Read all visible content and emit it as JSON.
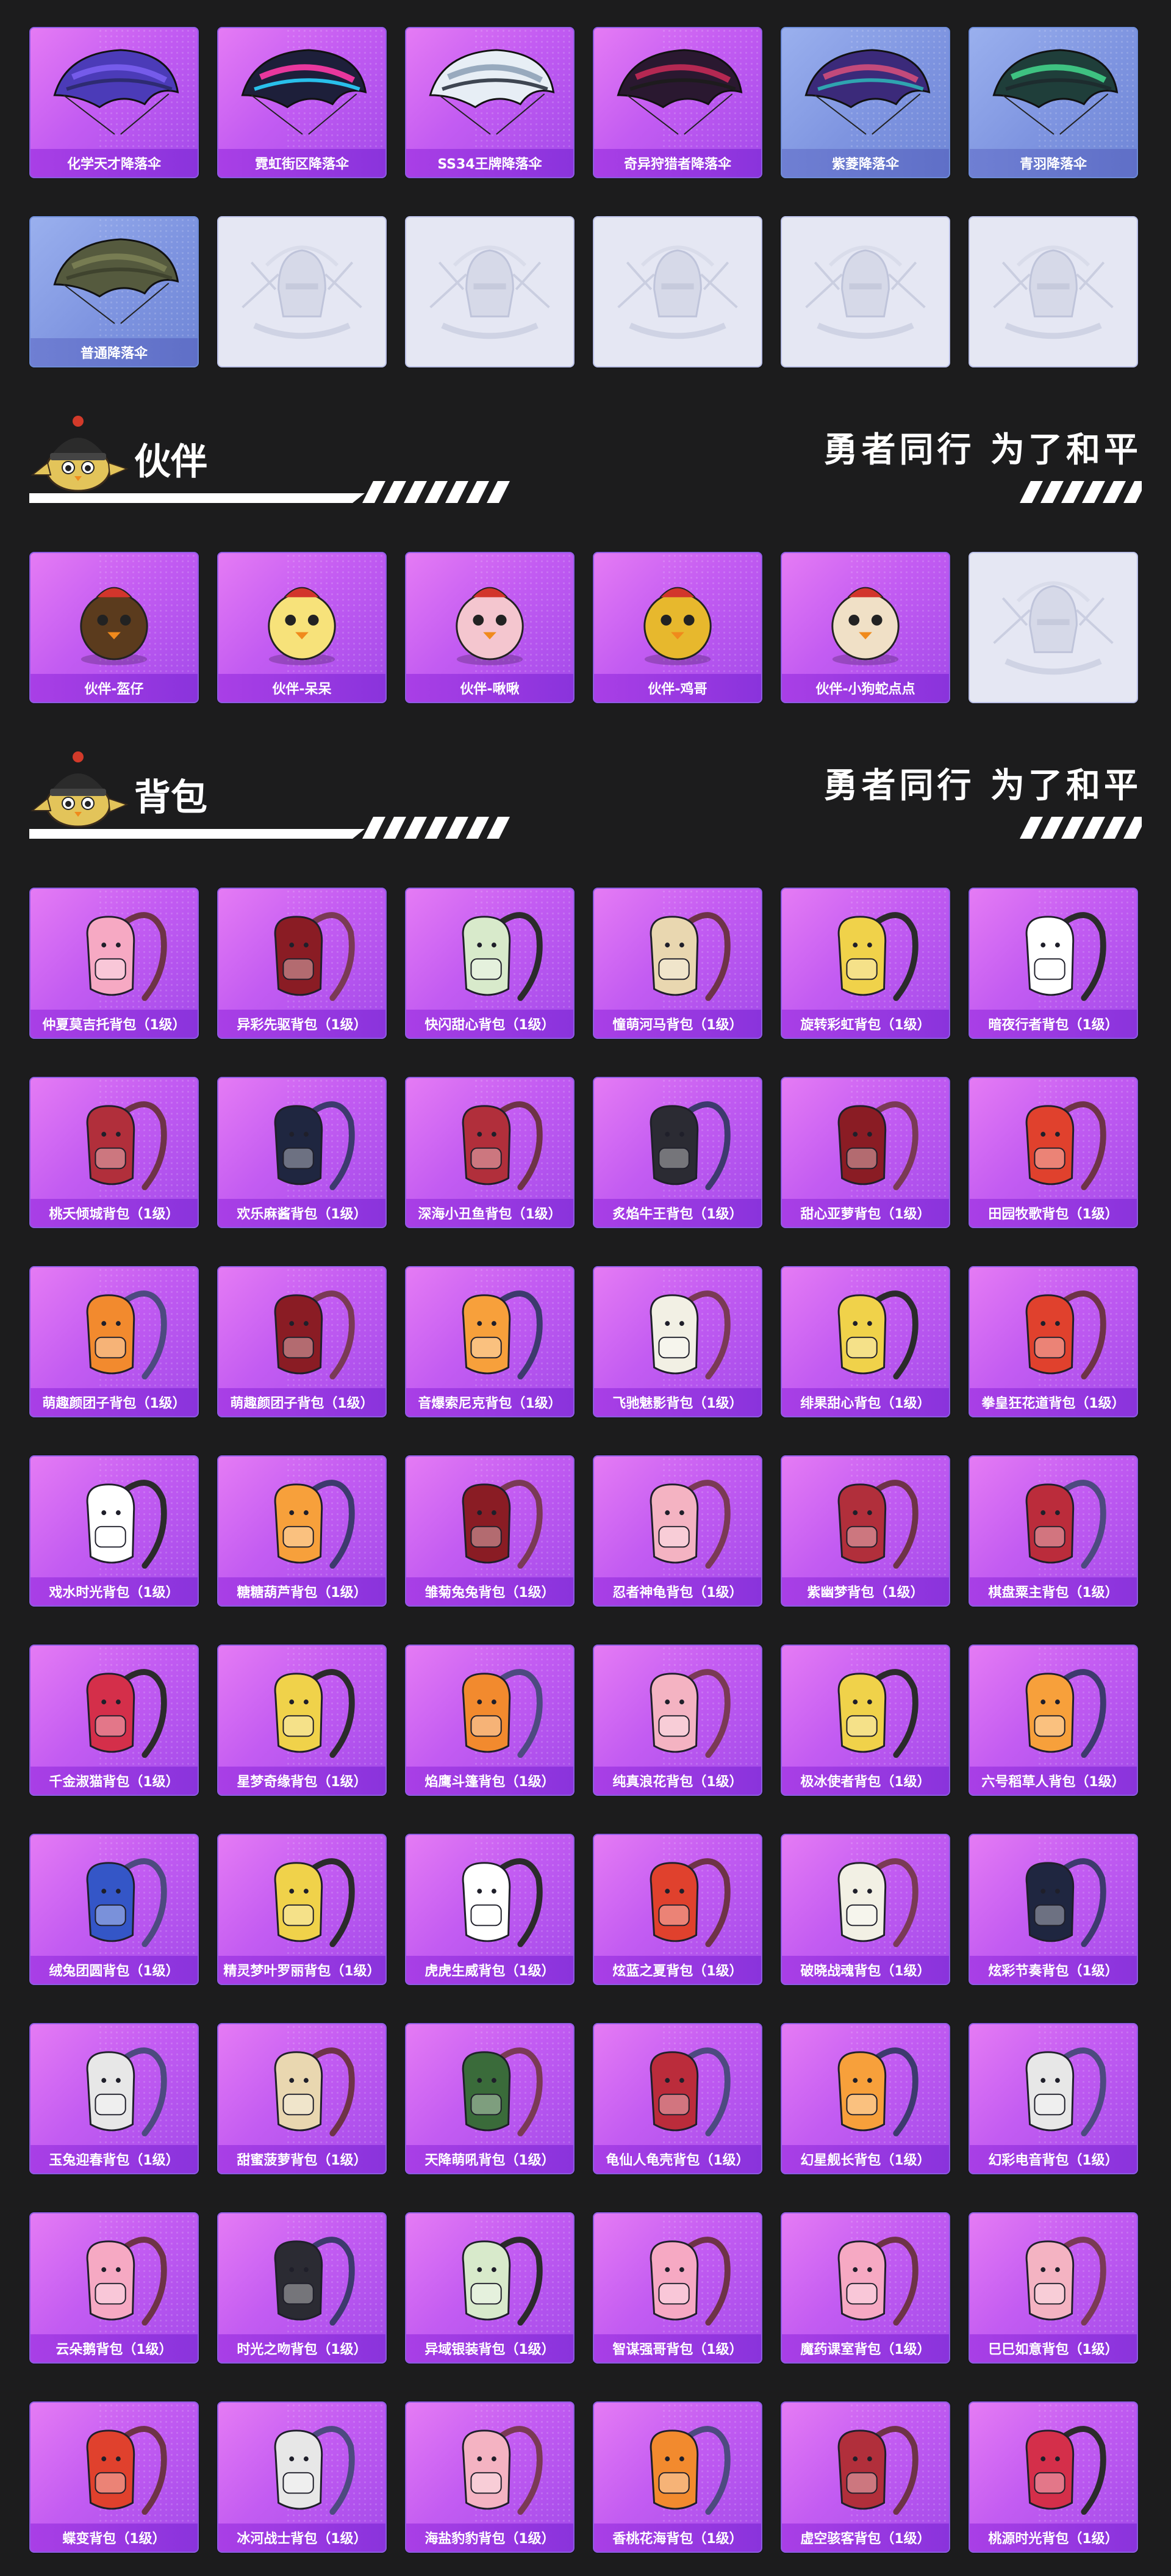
{
  "parachute_row1": [
    "化学天才降落伞",
    "霓虹街区降落伞",
    "SS34王牌降落伞",
    "奇异狩猎者降落伞",
    "紫菱降落伞",
    "青羽降落伞"
  ],
  "parachute_row2": [
    "普通降落伞",
    "",
    "",
    "",
    "",
    ""
  ],
  "companion_section": {
    "title": "伙伴",
    "slogan": "勇者同行 为了和平",
    "items": [
      "伙伴-盔仔",
      "伙伴-呆呆",
      "伙伴-啾啾",
      "伙伴-鸡哥",
      "伙伴-小狗蛇点点",
      ""
    ]
  },
  "backpack_section": {
    "title": "背包",
    "slogan": "勇者同行 为了和平",
    "items": [
      "仲夏莫吉托背包（1级）",
      "异彩先驱背包（1级）",
      "快闪甜心背包（1级）",
      "憧萌河马背包（1级）",
      "旋转彩虹背包（1级）",
      "暗夜行者背包（1级）",
      "桃夭倾城背包（1级）",
      "欢乐麻酱背包（1级）",
      "深海小丑鱼背包（1级）",
      "炙焰牛王背包（1级）",
      "甜心亚萝背包（1级）",
      "田园牧歌背包（1级）",
      "萌趣颜团子背包（1级）",
      "萌趣颜团子背包（1级）",
      "音爆索尼克背包（1级）",
      "飞驰魅影背包（1级）",
      "绯果甜心背包（1级）",
      "拳皇狂花道背包（1级）",
      "戏水时光背包（1级）",
      "糖糖葫芦背包（1级）",
      "雏菊兔兔背包（1级）",
      "忍者神龟背包（1级）",
      "紫幽梦背包（1级）",
      "棋盘粟主背包（1级）",
      "千金淑猫背包（1级）",
      "星梦奇缘背包（1级）",
      "焰鹰斗篷背包（1级）",
      "纯真浪花背包（1级）",
      "极冰使者背包（1级）",
      "六号稻草人背包（1级）",
      "绒兔团圆背包（1级）",
      "精灵梦叶罗丽背包（1级）",
      "虎虎生威背包（1级）",
      "炫蓝之夏背包（1级）",
      "破晓战魂背包（1级）",
      "炫彩节奏背包（1级）",
      "玉兔迎春背包（1级）",
      "甜蜜菠萝背包（1级）",
      "天降萌吼背包（1级）",
      "龟仙人龟壳背包（1级）",
      "幻星舰长背包（1级）",
      "幻彩电音背包（1级）",
      "云朵鹅背包（1级）",
      "时光之吻背包（1级）",
      "异域银装背包（1级）",
      "智谋强哥背包（1级）",
      "魔药课室背包（1级）",
      "巳巳如意背包（1级）",
      "蝶变背包（1级）",
      "冰河战士背包（1级）",
      "海盐豹豹背包（1级）",
      "香桃花海背包（1级）",
      "虚空骇客背包（1级）",
      "桃源时光背包（1级）"
    ]
  },
  "colors": {
    "background": "#1c1c1d",
    "card_purple": "#c35cf2",
    "card_blue": "#7e94e0",
    "card_empty": "#e5e7f3"
  }
}
